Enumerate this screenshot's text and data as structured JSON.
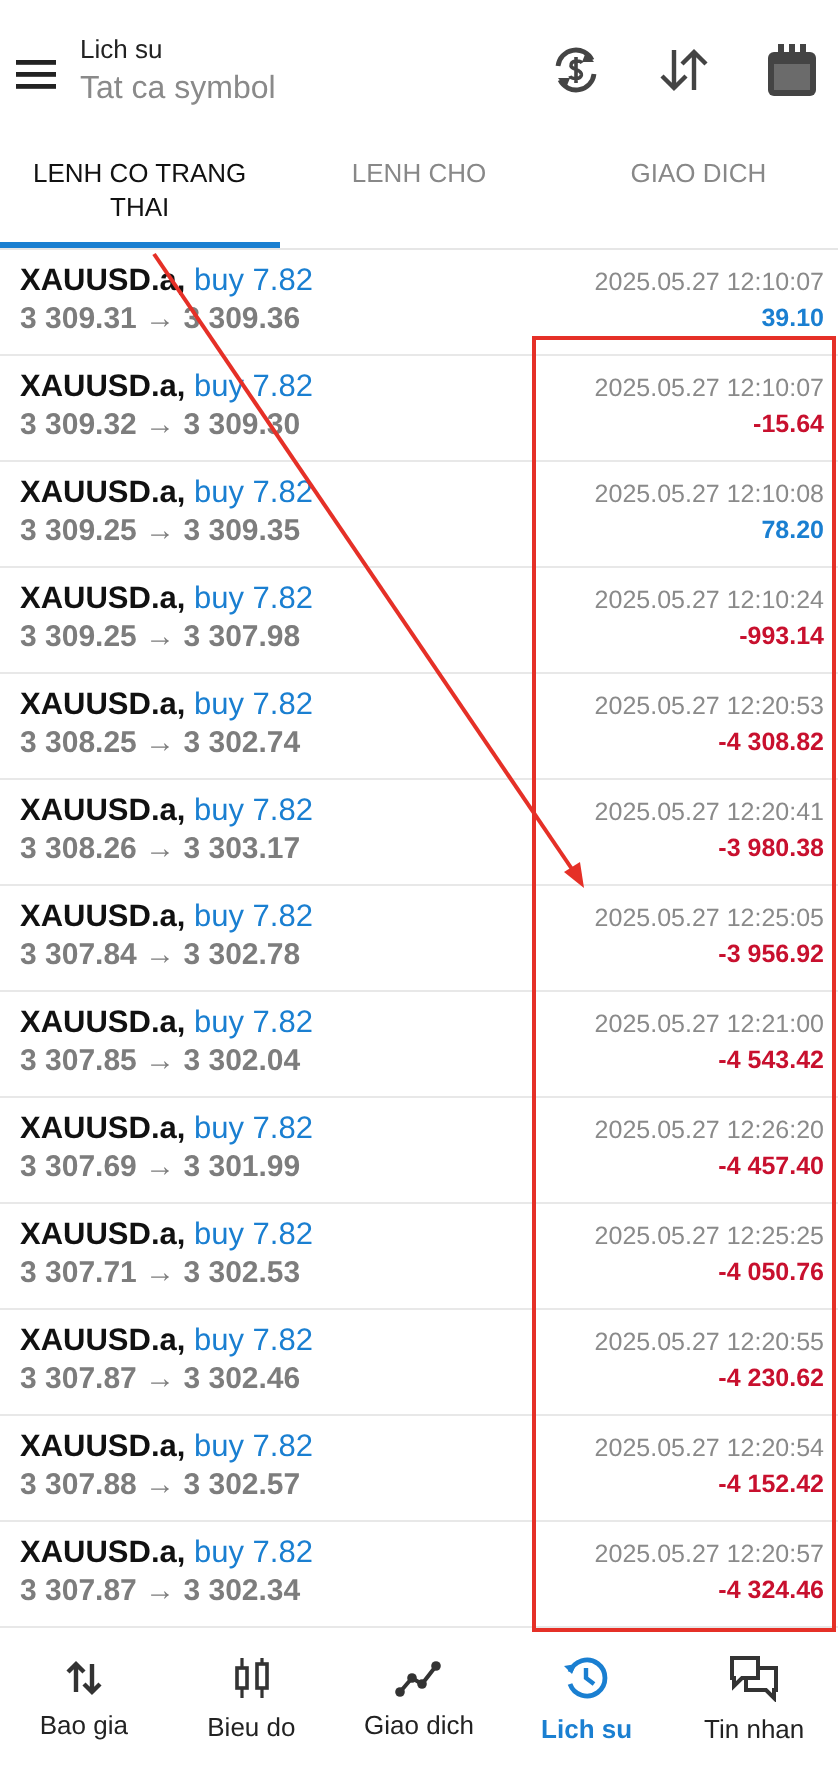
{
  "header": {
    "title": "Lich su",
    "subtitle": "Tat ca symbol"
  },
  "tabs": [
    {
      "label": "LENH CO TRANG THAI",
      "selected": true
    },
    {
      "label": "LENH CHO",
      "selected": false
    },
    {
      "label": "GIAO DICH",
      "selected": false
    }
  ],
  "deals": [
    {
      "symbol": "XAUUSD.a,",
      "side": "buy 7.82",
      "prices": "3 309.31 → 3 309.36",
      "time": "2025.05.27 12:10:07",
      "profit": "39.10",
      "color": "#1a7fd1"
    },
    {
      "symbol": "XAUUSD.a,",
      "side": "buy 7.82",
      "prices": "3 309.32 → 3 309.30",
      "time": "2025.05.27 12:10:07",
      "profit": "-15.64",
      "color": "#c8102e"
    },
    {
      "symbol": "XAUUSD.a,",
      "side": "buy 7.82",
      "prices": "3 309.25 → 3 309.35",
      "time": "2025.05.27 12:10:08",
      "profit": "78.20",
      "color": "#1a7fd1"
    },
    {
      "symbol": "XAUUSD.a,",
      "side": "buy 7.82",
      "prices": "3 309.25 → 3 307.98",
      "time": "2025.05.27 12:10:24",
      "profit": "-993.14",
      "color": "#c8102e"
    },
    {
      "symbol": "XAUUSD.a,",
      "side": "buy 7.82",
      "prices": "3 308.25 → 3 302.74",
      "time": "2025.05.27 12:20:53",
      "profit": "-4 308.82",
      "color": "#c8102e"
    },
    {
      "symbol": "XAUUSD.a,",
      "side": "buy 7.82",
      "prices": "3 308.26 → 3 303.17",
      "time": "2025.05.27 12:20:41",
      "profit": "-3 980.38",
      "color": "#c8102e"
    },
    {
      "symbol": "XAUUSD.a,",
      "side": "buy 7.82",
      "prices": "3 307.84 → 3 302.78",
      "time": "2025.05.27 12:25:05",
      "profit": "-3 956.92",
      "color": "#c8102e"
    },
    {
      "symbol": "XAUUSD.a,",
      "side": "buy 7.82",
      "prices": "3 307.85 → 3 302.04",
      "time": "2025.05.27 12:21:00",
      "profit": "-4 543.42",
      "color": "#c8102e"
    },
    {
      "symbol": "XAUUSD.a,",
      "side": "buy 7.82",
      "prices": "3 307.69 → 3 301.99",
      "time": "2025.05.27 12:26:20",
      "profit": "-4 457.40",
      "color": "#c8102e"
    },
    {
      "symbol": "XAUUSD.a,",
      "side": "buy 7.82",
      "prices": "3 307.71 → 3 302.53",
      "time": "2025.05.27 12:25:25",
      "profit": "-4 050.76",
      "color": "#c8102e"
    },
    {
      "symbol": "XAUUSD.a,",
      "side": "buy 7.82",
      "prices": "3 307.87 → 3 302.46",
      "time": "2025.05.27 12:20:55",
      "profit": "-4 230.62",
      "color": "#c8102e"
    },
    {
      "symbol": "XAUUSD.a,",
      "side": "buy 7.82",
      "prices": "3 307.88 → 3 302.57",
      "time": "2025.05.27 12:20:54",
      "profit": "-4 152.42",
      "color": "#c8102e"
    },
    {
      "symbol": "XAUUSD.a,",
      "side": "buy 7.82",
      "prices": "3 307.87 → 3 302.34",
      "time": "2025.05.27 12:20:57",
      "profit": "-4 324.46",
      "color": "#c8102e"
    }
  ],
  "nav": [
    {
      "label": "Bao gia",
      "kind": "quotes",
      "selected": false
    },
    {
      "label": "Bieu do",
      "kind": "chart",
      "selected": false
    },
    {
      "label": "Giao dich",
      "kind": "trade",
      "selected": false
    },
    {
      "label": "Lich su",
      "kind": "history",
      "selected": true
    },
    {
      "label": "Tin nhan",
      "kind": "messages",
      "selected": false
    }
  ]
}
